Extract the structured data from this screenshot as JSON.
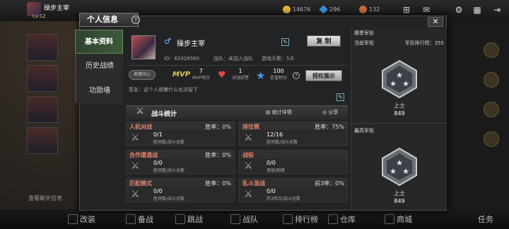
{
  "topbar": {
    "player_name": "操步主宰",
    "level": "Lv.12",
    "gold": "14676",
    "diamond": "296",
    "tickets": "132"
  },
  "chat": {
    "line": "查看聊天信息"
  },
  "bottombar": {
    "items": [
      "改装",
      "备战",
      "跳战",
      "战队",
      "排行榜",
      "仓库",
      "商城",
      "任务"
    ]
  },
  "modal": {
    "title": "个人信息",
    "close": "✕",
    "help": "?"
  },
  "sidenav": {
    "items": [
      "基本资料",
      "历史战绩",
      "功勋墙"
    ]
  },
  "profile": {
    "gender_symbol": "♂",
    "name": "操步主宰",
    "copy_label": "复 制",
    "id_text": "ID：62928560",
    "team_text": "战队：未加入战队",
    "days_text": "游戏天数：5天",
    "emote_chip": "表情中心",
    "mvp_label": "MVP",
    "mvp_value": "7",
    "mvp_sub": "MVP场次",
    "like_value": "1",
    "like_sub": "对战获赞",
    "score_value": "100",
    "score_sub": "信誉积分",
    "auth_label": "授权展示",
    "signature": "签名：这个人很懒什么也没留下"
  },
  "battle": {
    "title": "战斗统计",
    "detail_link": "统计详情",
    "share_link": "分享",
    "modes": [
      {
        "name": "人机对战",
        "rate": "胜率：0%",
        "value": "0/1",
        "sub": "胜场数/战斗总数"
      },
      {
        "name": "排位赛",
        "rate": "胜率：75%",
        "value": "12/16",
        "sub": "胜场数/战斗总数"
      },
      {
        "name": "合作遭遇战",
        "rate": "胜率：0%",
        "value": "0/0",
        "sub": "胜场数/战斗总数"
      },
      {
        "name": "战役",
        "rate": "",
        "value": "0/0",
        "sub": "普级/困难"
      },
      {
        "name": "匹配模式",
        "rate": "胜率：0%",
        "value": "0/0",
        "sub": "胜场数/战斗总数"
      },
      {
        "name": "乱斗混战",
        "rate": "前3率：0%",
        "value": "0/0",
        "sub": "前3场次/战斗总数"
      }
    ]
  },
  "rank": {
    "season_label": "赛季军衔",
    "current_label": "当前军衔",
    "position_text": "军衔排行榜：355",
    "current_name": "上士",
    "current_score": "849",
    "best_label": "最高军衔",
    "best_name": "上士",
    "best_score": "849"
  },
  "colors": {
    "accent_green": "#3c5a3a",
    "mode_title": "#e0806a",
    "gold": "#e6c65a",
    "blue": "#4c95e0"
  }
}
